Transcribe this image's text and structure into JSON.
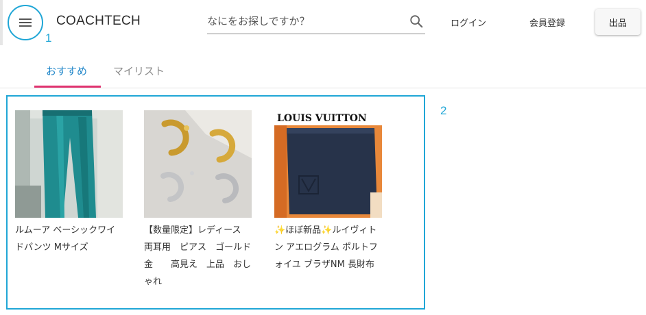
{
  "header": {
    "logo": "COACHTECH",
    "search_placeholder": "なにをお探しですか？",
    "login": "ログイン",
    "register": "会員登録",
    "sell": "出品"
  },
  "annotations": {
    "label_1": "1",
    "label_2": "2"
  },
  "tabs": [
    {
      "label": "おすすめ",
      "active": true
    },
    {
      "label": "マイリスト",
      "active": false
    }
  ],
  "products": [
    {
      "name": "ルムーア ベーシックワイドパンツ Mサイズ",
      "thumb_alt": "teal-wide-pants"
    },
    {
      "name": "【数量限定】レディース　両耳用　ピアス　ゴールド　金　　高見え　上品　おしゃれ",
      "thumb_alt": "gold-silver-earrings"
    },
    {
      "name": "✨ほぼ新品✨ルイヴィトン アエログラム ポルトフォイユ ブラザNM 長財布",
      "thumb_alt": "louis-vuitton-wallet",
      "box_text": "LOUIS VUITTON"
    }
  ],
  "colors": {
    "accent": "#1fa6d6",
    "tab_active": "#1f86c9",
    "tab_underline": "#e0326f"
  }
}
